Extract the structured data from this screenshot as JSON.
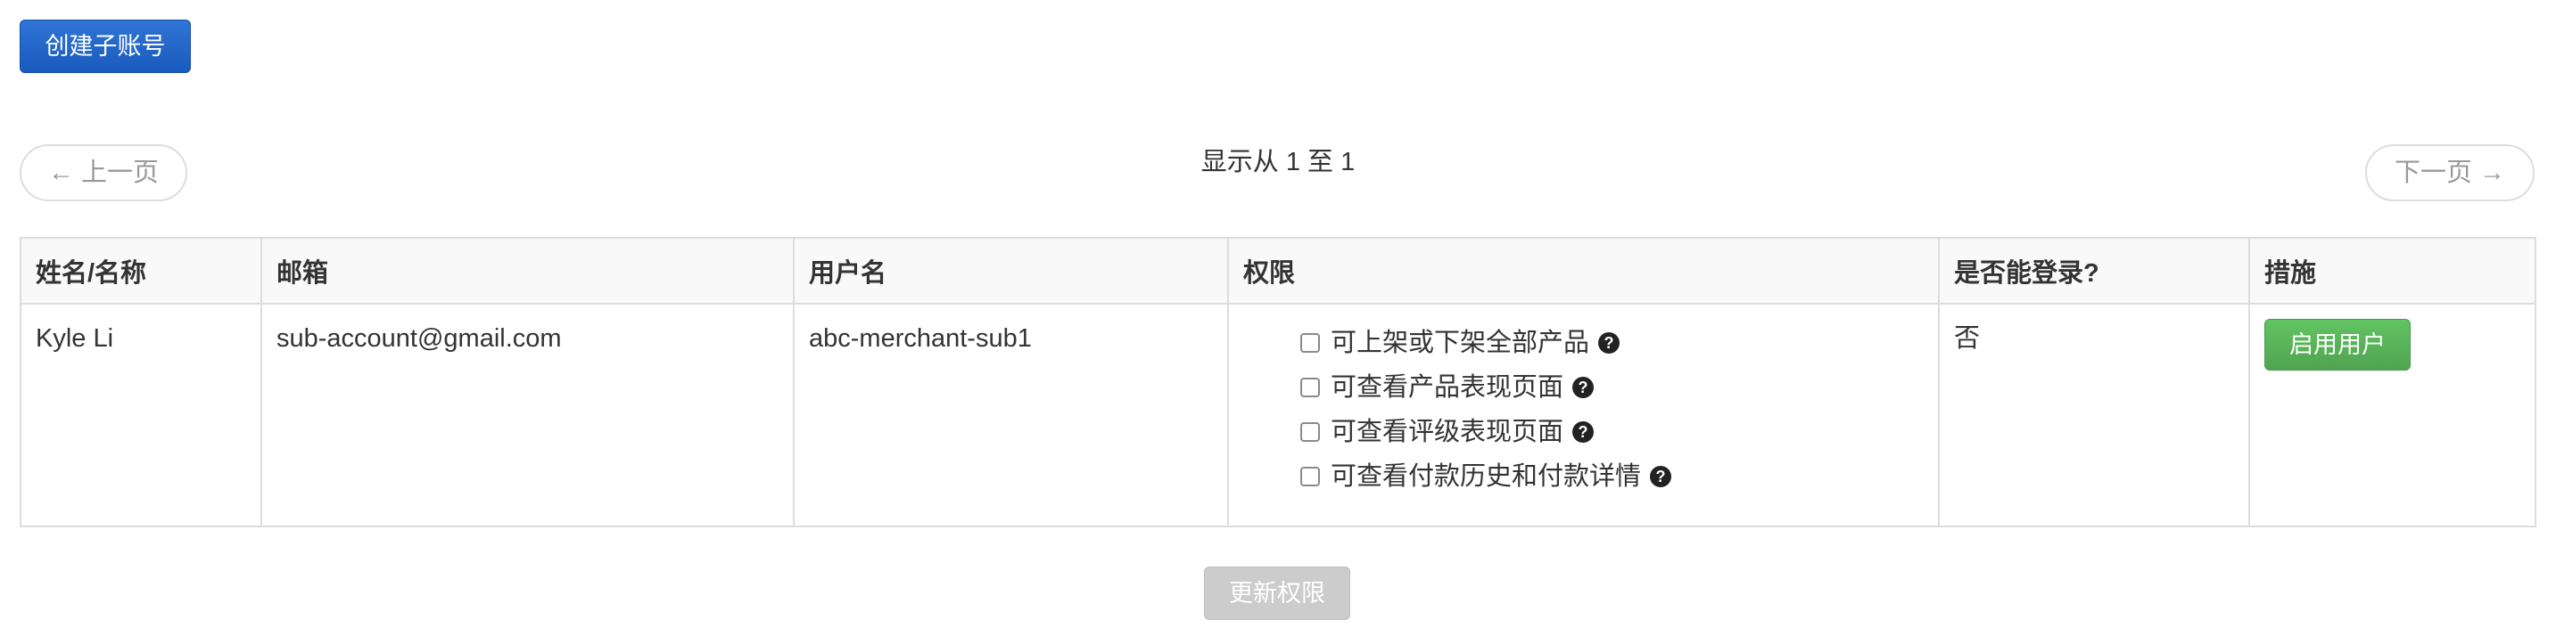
{
  "toolbar": {
    "create_label": "创建子账号"
  },
  "pager": {
    "prev_label": "← 上一页",
    "next_label": "下一页 →",
    "info": "显示从 1 至 1"
  },
  "table": {
    "headers": [
      "姓名/名称",
      "邮箱",
      "用户名",
      "权限",
      "是否能登录?",
      "措施"
    ],
    "rows": [
      {
        "name": "Kyle Li",
        "email": "sub-account@gmail.com",
        "username": "abc-merchant-sub1",
        "permissions": [
          {
            "label": "可上架或下架全部产品",
            "checked": false
          },
          {
            "label": "可查看产品表现页面",
            "checked": false
          },
          {
            "label": "可查看评级表现页面",
            "checked": false
          },
          {
            "label": "可查看付款历史和付款详情",
            "checked": false
          }
        ],
        "can_login": "否",
        "action_label": "启用用户"
      }
    ]
  },
  "footer": {
    "update_label": "更新权限"
  },
  "icons": {
    "help": "question-circle-icon"
  },
  "colors": {
    "primary": "#1a5bbd",
    "success": "#51a351",
    "disabled": "#cccccc"
  }
}
